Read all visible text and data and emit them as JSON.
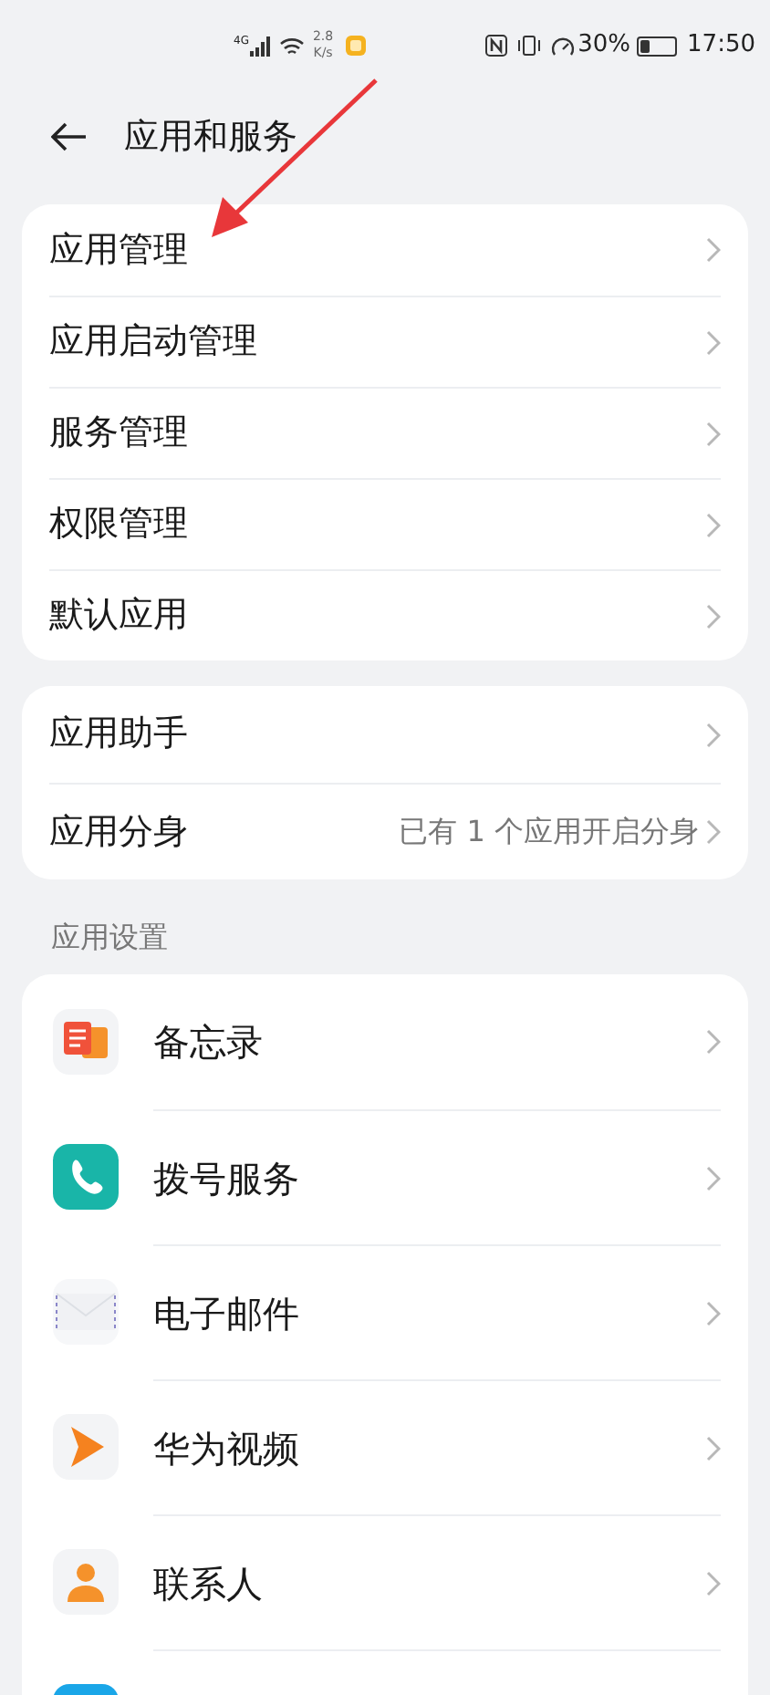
{
  "status_bar": {
    "signal_label": "4G",
    "speed_value": "2.8",
    "speed_unit": "K/s",
    "battery_text": "30%",
    "time": "17:50"
  },
  "header": {
    "title": "应用和服务"
  },
  "group_1": [
    {
      "label": "应用管理"
    },
    {
      "label": "应用启动管理"
    },
    {
      "label": "服务管理"
    },
    {
      "label": "权限管理"
    },
    {
      "label": "默认应用"
    }
  ],
  "group_2": [
    {
      "label": "应用助手"
    },
    {
      "label": "应用分身",
      "value": "已有 1 个应用开启分身"
    }
  ],
  "section_title": "应用设置",
  "apps": [
    {
      "kind": "memo",
      "label": "备忘录"
    },
    {
      "kind": "phone",
      "label": "拨号服务"
    },
    {
      "kind": "mail",
      "label": "电子邮件"
    },
    {
      "kind": "video",
      "label": "华为视频"
    },
    {
      "kind": "contact",
      "label": "联系人"
    },
    {
      "kind": "partial"
    }
  ]
}
